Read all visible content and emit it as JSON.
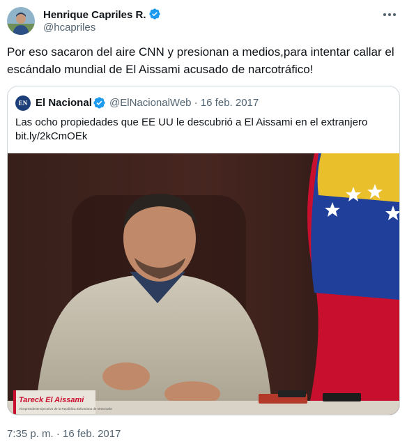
{
  "author": {
    "name": "Henrique Capriles R.",
    "handle": "@hcapriles",
    "verified_icon": "verified-badge-icon",
    "accent": "#1d9bf0"
  },
  "tweet": {
    "text": "Por eso sacaron del aire CNN y presionan a medios,para intentar callar el escándalo mundial de El Aissami acusado de narcotráfico!",
    "timestamp": "7:35 p. m. · 16 feb. 2017"
  },
  "quoted": {
    "logo_text": "EN",
    "name": "El Nacional",
    "handle_date": "@ElNacionalWeb · 16 feb. 2017",
    "text": "Las ocho propiedades que EE UU le descubrió a El Aissami en el extranjero",
    "link": "bit.ly/2kCmOEk",
    "image": {
      "caption_name": "Tareck El Aissami",
      "caption_sub": "Vicepresidente Ejecutivo de la República Bolivariana de Venezuela"
    }
  }
}
